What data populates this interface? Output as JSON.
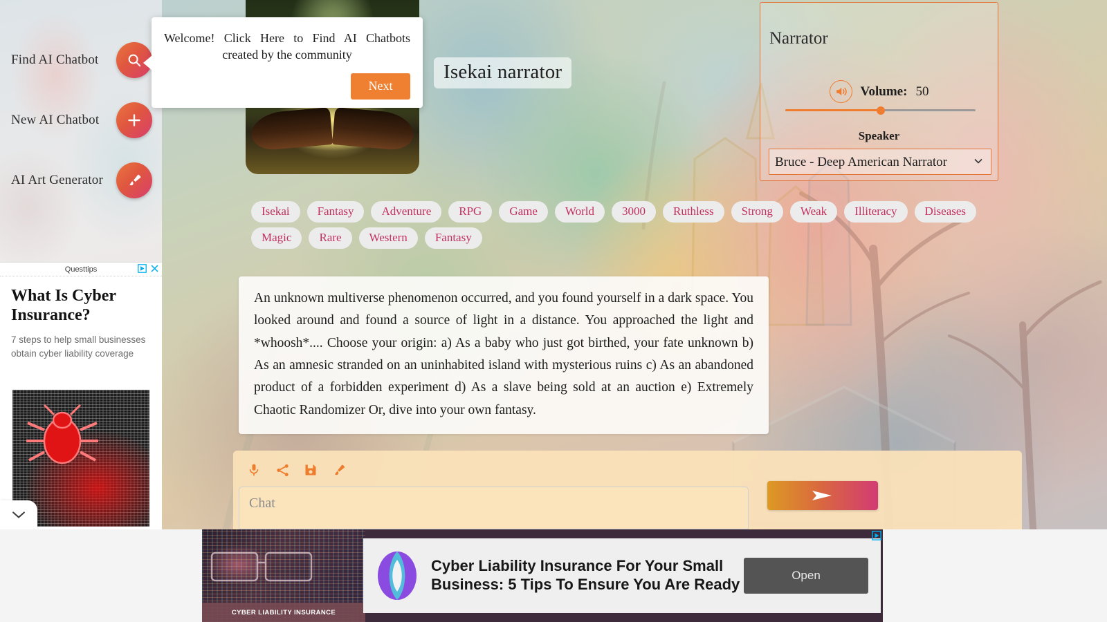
{
  "sidebar": {
    "items": [
      {
        "label": "Find AI Chatbot",
        "icon": "search-icon"
      },
      {
        "label": "New AI Chatbot",
        "icon": "plus-icon"
      },
      {
        "label": "AI Art Generator",
        "icon": "paintbrush-icon"
      }
    ],
    "ad": {
      "brand": "Questtips",
      "title": "What Is Cyber Insurance?",
      "subtitle": "7 steps to help small businesses obtain cyber liability coverage",
      "adchoices_icon": "adchoices-icon",
      "close_icon": "close-icon",
      "collapse_icon": "chevron-down-icon"
    }
  },
  "tooltip": {
    "text": "Welcome! Click Here to Find AI Chatbots created by the community",
    "next_label": "Next"
  },
  "character": {
    "title": "Isekai narrator",
    "avatar_alt": "glowing open book in forest",
    "tags": [
      "Isekai",
      "Fantasy",
      "Adventure",
      "RPG",
      "Game",
      "World",
      "3000",
      "Ruthless",
      "Strong",
      "Weak",
      "Illiteracy",
      "Diseases",
      "Magic",
      "Rare",
      "Western",
      "Fantasy"
    ]
  },
  "story": {
    "message": "An unknown multiverse phenomenon occurred, and you found yourself in a dark space. You looked around and found a source of light in a distance. You approached the light and *whoosh*.... Choose your origin: a) As a baby who just got birthed, your fate unknown b) As an amnesic stranded on an uninhabited island with mysterious ruins c) As an abandoned product of a forbidden experiment d) As a slave being sold at an auction e) Extremely Chaotic Randomizer Or, dive into your own fantasy."
  },
  "composer": {
    "tools": [
      {
        "name": "microphone-icon",
        "label": "Voice input"
      },
      {
        "name": "share-icon",
        "label": "Share"
      },
      {
        "name": "save-icon",
        "label": "Save"
      },
      {
        "name": "paintbrush-icon",
        "label": "Generate art"
      }
    ],
    "chat_value": "",
    "chat_placeholder": "Chat",
    "send_icon": "send-icon"
  },
  "narrator": {
    "title": "Narrator",
    "volume_label": "Volume:",
    "volume_value": "50",
    "volume_percent": 50,
    "volume_icon": "speaker-volume-icon",
    "speaker_label": "Speaker",
    "speaker_selected": "Bruce - Deep American Narrator",
    "speaker_options": [
      "Bruce - Deep American Narrator"
    ]
  },
  "bottom_ad": {
    "photo_caption": "CYBER LIABILITY INSURANCE",
    "headline": "Cyber Liability Insurance For Your Small Business: 5 Tips To Ensure You Are Ready",
    "open_label": "Open",
    "adchoices_icon": "adchoices-icon"
  },
  "colors": {
    "accent_orange": "#ef7c2f",
    "accent_pink": "#d33b73",
    "tag_text": "#c23160",
    "panel_border": "#e2763a",
    "composer_bg": "#fbe2b9"
  }
}
